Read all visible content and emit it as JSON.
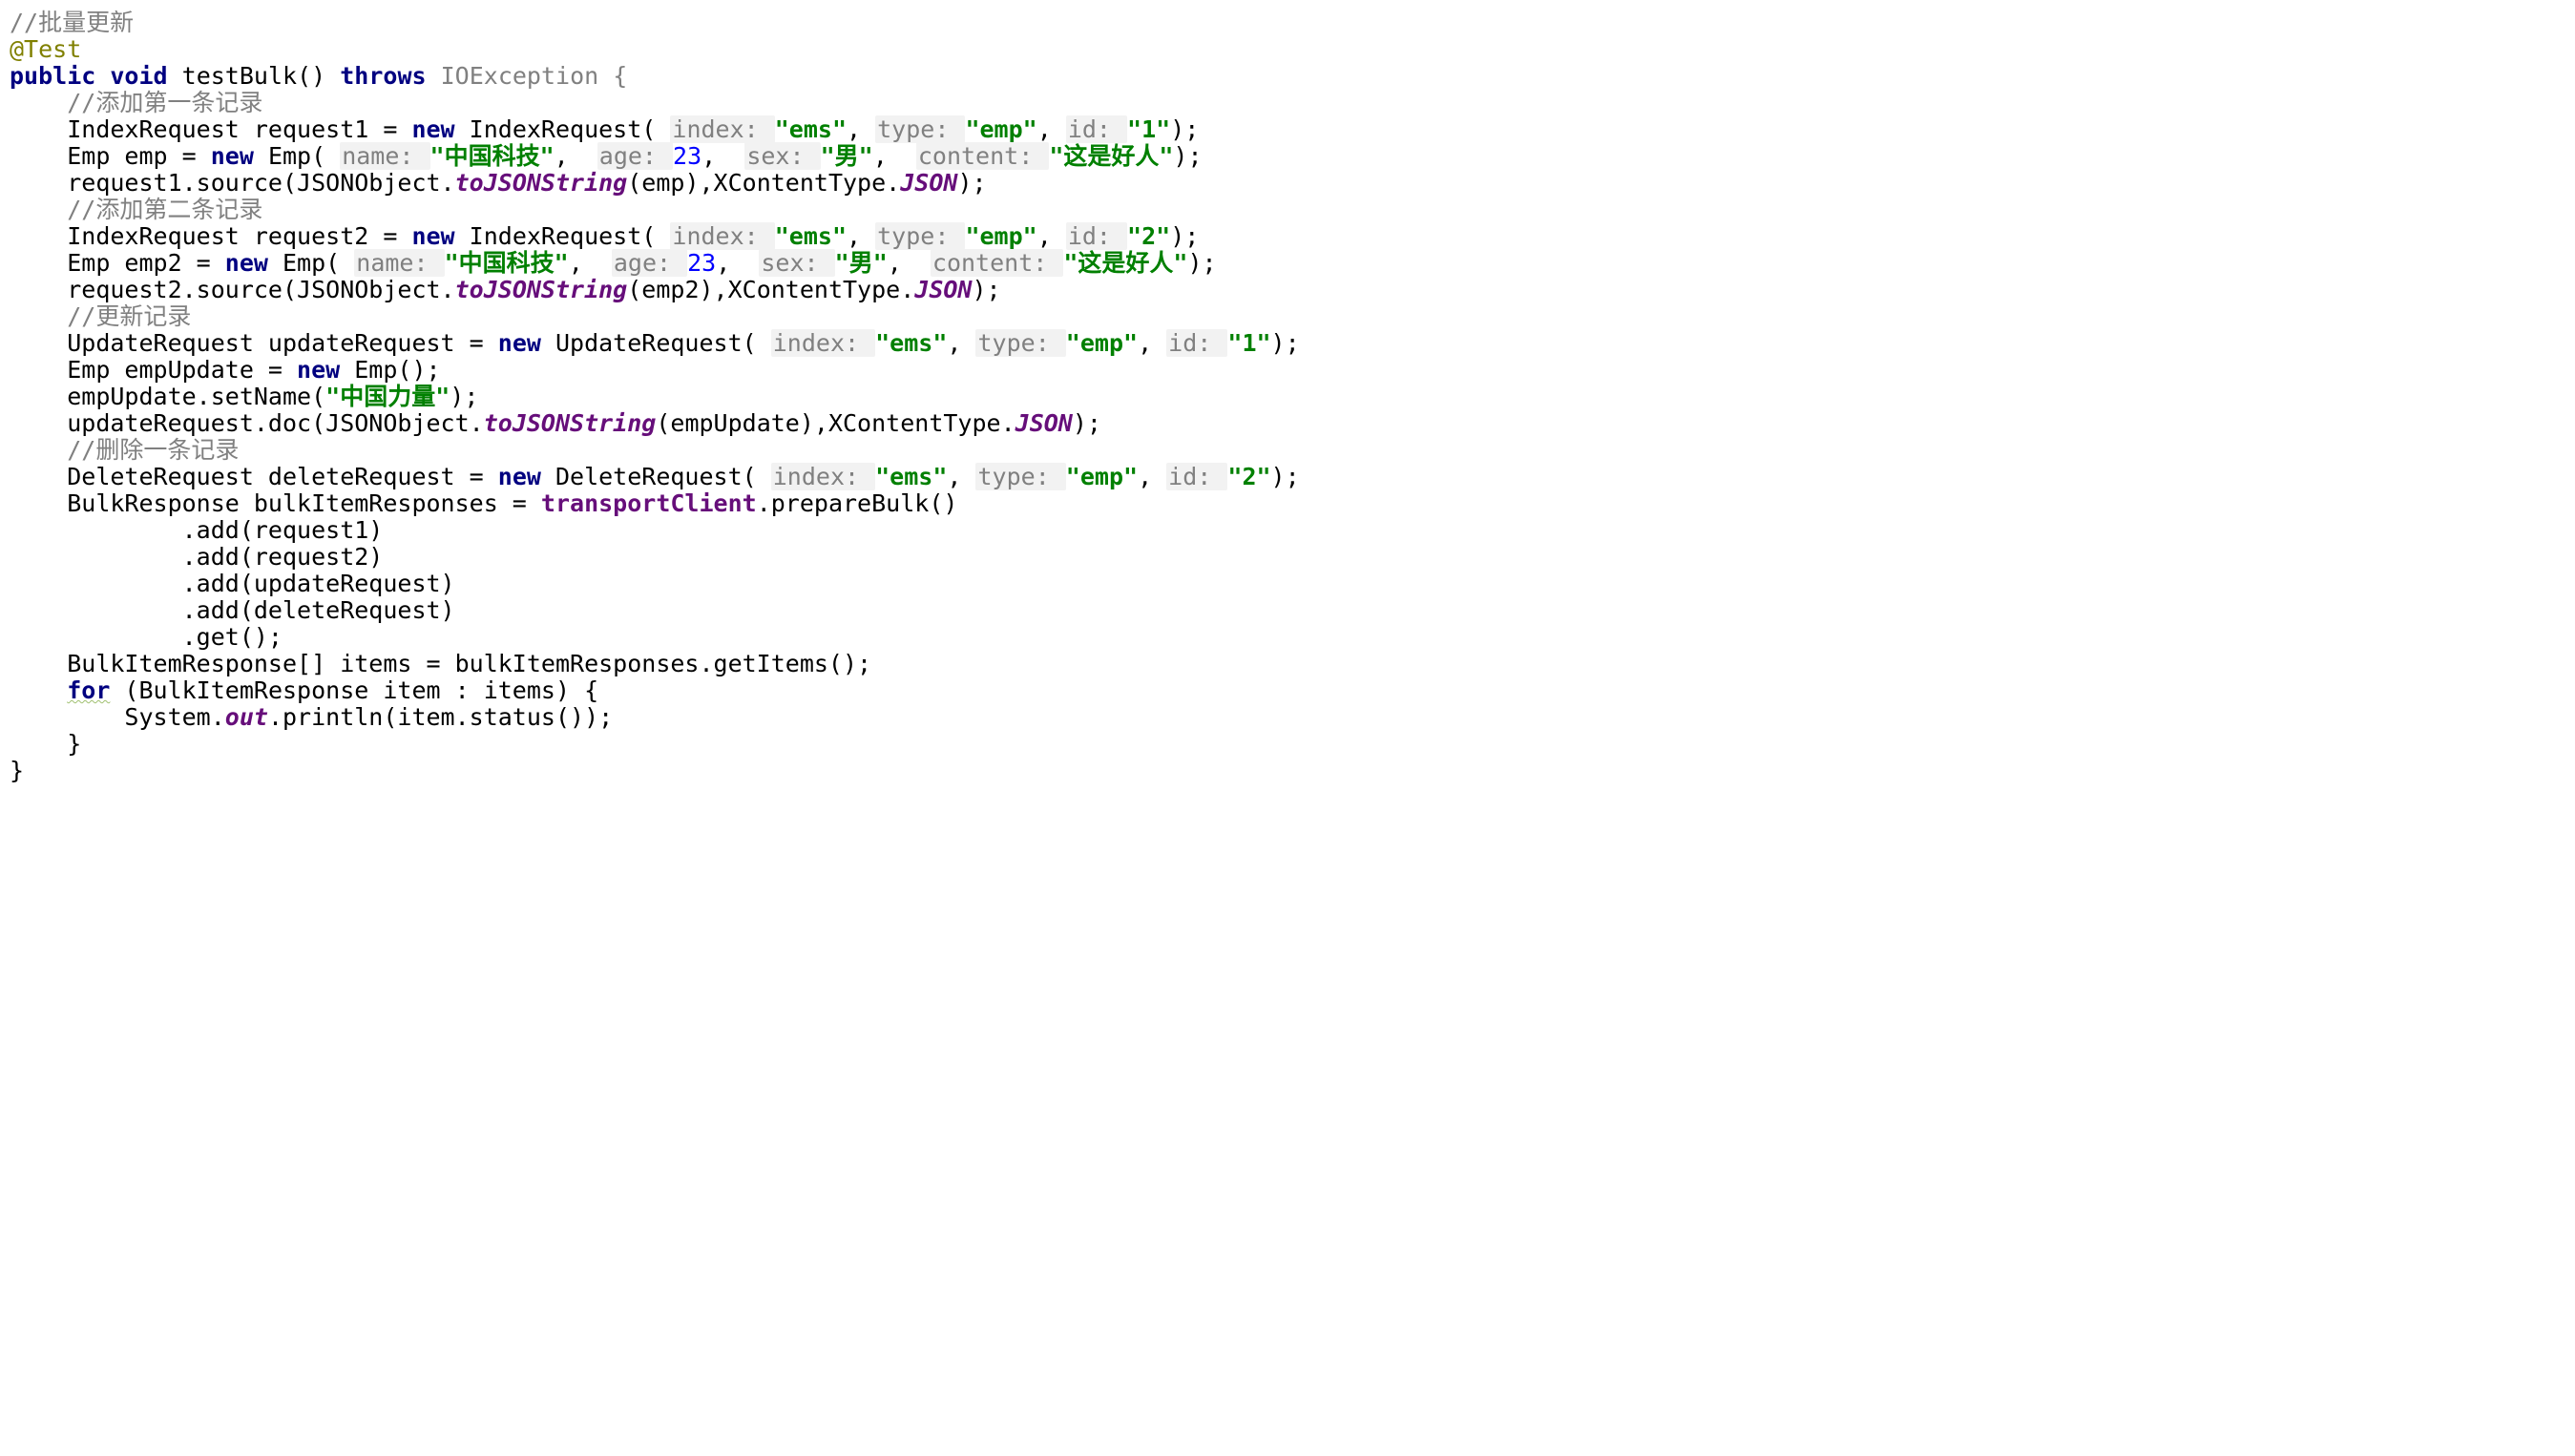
{
  "code": {
    "l01_comment": "//批量更新",
    "l02_anno": "@Test",
    "l03_public": "public",
    "l03_void": "void",
    "l03_name": "testBulk()",
    "l03_throws": "throws",
    "l03_ex": "IOException {",
    "l04_comment": "//添加第一条记录",
    "l05_a": "IndexRequest request1 = ",
    "l05_new": "new",
    "l05_b": " IndexRequest( ",
    "l05_p1": "index: ",
    "l05_s1": "\"ems\"",
    "l05_c": ", ",
    "l05_p2": "type: ",
    "l05_s2": "\"emp\"",
    "l05_d": ", ",
    "l05_p3": "id: ",
    "l05_s3": "\"1\"",
    "l05_e": ");",
    "l06_a": "Emp emp = ",
    "l06_new": "new",
    "l06_b": " Emp( ",
    "l06_p1": "name: ",
    "l06_s1": "\"中国科技\"",
    "l06_c": ",  ",
    "l06_p2": "age: ",
    "l06_n1": "23",
    "l06_d": ",  ",
    "l06_p3": "sex: ",
    "l06_s2": "\"男\"",
    "l06_e": ",  ",
    "l06_p4": "content: ",
    "l06_s3": "\"这是好人\"",
    "l06_f": ");",
    "l07_a": "request1.source(JSONObject.",
    "l07_m": "toJSONString",
    "l07_b": "(emp),XContentType.",
    "l07_f": "JSON",
    "l07_c": ");",
    "l08_comment": "//添加第二条记录",
    "l09_a": "IndexRequest request2 = ",
    "l09_new": "new",
    "l09_b": " IndexRequest( ",
    "l09_p1": "index: ",
    "l09_s1": "\"ems\"",
    "l09_c": ", ",
    "l09_p2": "type: ",
    "l09_s2": "\"emp\"",
    "l09_d": ", ",
    "l09_p3": "id: ",
    "l09_s3": "\"2\"",
    "l09_e": ");",
    "l10_a": "Emp emp2 = ",
    "l10_new": "new",
    "l10_b": " Emp( ",
    "l10_p1": "name: ",
    "l10_s1": "\"中国科技\"",
    "l10_c": ",  ",
    "l10_p2": "age: ",
    "l10_n1": "23",
    "l10_d": ",  ",
    "l10_p3": "sex: ",
    "l10_s2": "\"男\"",
    "l10_e": ",  ",
    "l10_p4": "content: ",
    "l10_s3": "\"这是好人\"",
    "l10_f": ");",
    "l11_a": "request2.source(JSONObject.",
    "l11_m": "toJSONString",
    "l11_b": "(emp2),XContentType.",
    "l11_f": "JSON",
    "l11_c": ");",
    "l12_comment": "//更新记录",
    "l13_a": "UpdateRequest updateRequest = ",
    "l13_new": "new",
    "l13_b": " UpdateRequest( ",
    "l13_p1": "index: ",
    "l13_s1": "\"ems\"",
    "l13_c": ", ",
    "l13_p2": "type: ",
    "l13_s2": "\"emp\"",
    "l13_d": ", ",
    "l13_p3": "id: ",
    "l13_s3": "\"1\"",
    "l13_e": ");",
    "l14_a": "Emp empUpdate = ",
    "l14_new": "new",
    "l14_b": " Emp();",
    "l15_a": "empUpdate.setName(",
    "l15_s": "\"中国力量\"",
    "l15_b": ");",
    "l16_a": "updateRequest.doc(JSONObject.",
    "l16_m": "toJSONString",
    "l16_b": "(empUpdate),XContentType.",
    "l16_f": "JSON",
    "l16_c": ");",
    "l17_comment": "//删除一条记录",
    "l18_a": "DeleteRequest deleteRequest = ",
    "l18_new": "new",
    "l18_b": " DeleteRequest( ",
    "l18_p1": "index: ",
    "l18_s1": "\"ems\"",
    "l18_c": ", ",
    "l18_p2": "type: ",
    "l18_s2": "\"emp\"",
    "l18_d": ", ",
    "l18_p3": "id: ",
    "l18_s3": "\"2\"",
    "l18_e": ");",
    "l19_a": "BulkResponse bulkItemResponses = ",
    "l19_f": "transportClient",
    "l19_b": ".prepareBulk()",
    "l20": ".add(request1)",
    "l21": ".add(request2)",
    "l22": ".add(updateRequest)",
    "l23": ".add(deleteRequest)",
    "l24": ".get();",
    "l25": "BulkItemResponse[] items = bulkItemResponses.getItems();",
    "l26_for": "for",
    "l26_a": " (BulkItemResponse item : items) {",
    "l27_a": "System.",
    "l27_f": "out",
    "l27_b": ".println(item.status());",
    "l28": "}",
    "l29": "}"
  }
}
